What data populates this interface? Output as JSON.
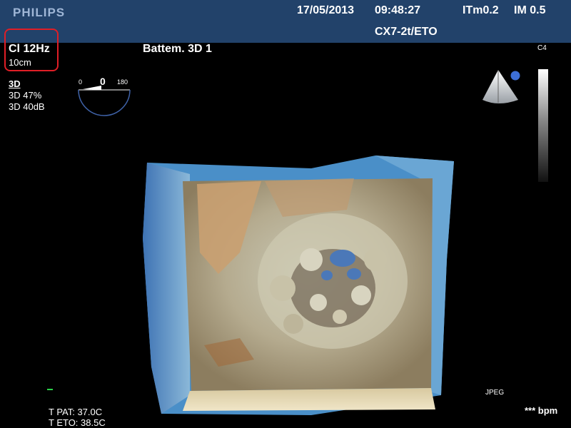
{
  "header": {
    "brand": "PHILIPS",
    "date": "17/05/2013",
    "time": "09:48:27",
    "thermal_index": "ITm0.2",
    "mechanical_index": "IM 0.5",
    "probe": "CX7-2t/ETO"
  },
  "acquisition": {
    "frequency": "Cl 12Hz",
    "depth": "10cm",
    "mode_title": "3D",
    "mode_percent": "3D 47%",
    "mode_gain": "3D 40dB",
    "preset": "Battem. 3D 1"
  },
  "rotation_indicator": {
    "min": "0",
    "current": "0",
    "max": "180"
  },
  "grayscale": {
    "map_label": "C4"
  },
  "footer": {
    "patient_temp": "T PAT: 37.0C",
    "probe_temp": "T ETO: 38.5C",
    "format": "JPEG",
    "heart_rate": "*** bpm"
  },
  "colors": {
    "header_bg": "#22426a",
    "highlight_box": "#e01e26",
    "volume_blue": "#4a8fc8",
    "volume_tan": "#c8a27a"
  }
}
